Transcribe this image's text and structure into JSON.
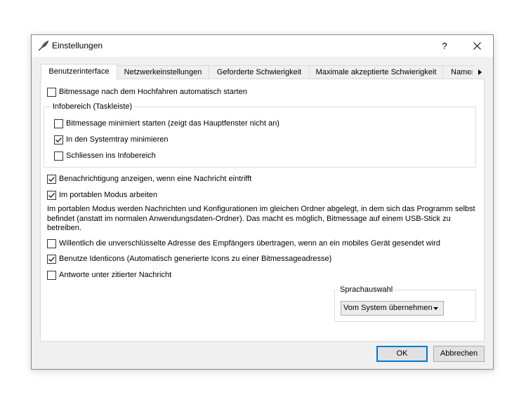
{
  "window": {
    "title": "Einstellungen",
    "help_label": "?"
  },
  "icons": {
    "title": "quill-icon",
    "close": "close-icon",
    "tab_scroll_left": "arrow-left-icon",
    "tab_scroll_right": "arrow-right-icon",
    "dropdown": "chevron-down-icon",
    "check": "checkmark-icon"
  },
  "tabs": [
    {
      "label": "Benutzerinterface",
      "selected": true
    },
    {
      "label": "Netzwerkeinstellungen",
      "selected": false
    },
    {
      "label": "Geforderte Schwierigkeit",
      "selected": false
    },
    {
      "label": "Maximale akzeptierte Schwierigkeit",
      "selected": false
    },
    {
      "label": "Name",
      "selected": false
    }
  ],
  "user_interface": {
    "start_on_boot": {
      "label": "Bitmessage nach dem Hochfahren automatisch starten",
      "checked": false
    },
    "tray_group": {
      "title": "Infobereich (Taskleiste)",
      "items": [
        {
          "label": "Bitmessage minimiert starten (zeigt das Hauptfenster nicht an)",
          "checked": false
        },
        {
          "label": "In den Systemtray minimieren",
          "checked": true
        },
        {
          "label": "Schliessen ins Infobereich",
          "checked": false
        }
      ]
    },
    "show_notification": {
      "label": "Benachrichtigung anzeigen, wenn eine Nachricht eintrifft",
      "checked": true
    },
    "portable_mode": {
      "label": "Im portablen Modus arbeiten",
      "checked": true
    },
    "portable_description_lines": [
      "Im portablen Modus werden Nachrichten und Konfigurationen im gleichen Ordner abgelegt, in dem sich das Programm selbst",
      "befindet (anstatt im normalen Anwendungsdaten-Ordner). Das macht es möglich, Bitmessage auf einem USB-Stick zu",
      "betreiben."
    ],
    "send_unencrypted_to_mobile": {
      "label": "Willentlich die unverschlüsselte Adresse des Empfängers übertragen, wenn an ein mobiles Gerät gesendet wird",
      "checked": false
    },
    "use_identicons": {
      "label": "Benutze Identicons (Automatisch generierte Icons zu einer Bitmessageadresse)",
      "checked": true
    },
    "reply_below_quote": {
      "label": "Antworte unter zitierter Nachricht",
      "checked": false
    },
    "language_group": {
      "title": "Sprachauswahl",
      "selected": "Vom System übernehmen"
    }
  },
  "buttons": {
    "ok": "OK",
    "cancel": "Abbrechen"
  },
  "colors": {
    "accent": "#0078d7"
  }
}
